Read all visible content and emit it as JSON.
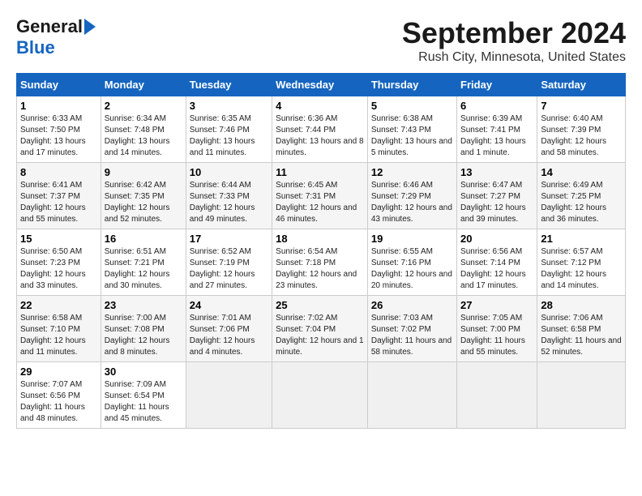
{
  "logo": {
    "text_general": "General",
    "text_blue": "Blue"
  },
  "title": "September 2024",
  "subtitle": "Rush City, Minnesota, United States",
  "days_of_week": [
    "Sunday",
    "Monday",
    "Tuesday",
    "Wednesday",
    "Thursday",
    "Friday",
    "Saturday"
  ],
  "weeks": [
    [
      {
        "day": "1",
        "sunrise": "6:33 AM",
        "sunset": "7:50 PM",
        "daylight": "13 hours and 17 minutes."
      },
      {
        "day": "2",
        "sunrise": "6:34 AM",
        "sunset": "7:48 PM",
        "daylight": "13 hours and 14 minutes."
      },
      {
        "day": "3",
        "sunrise": "6:35 AM",
        "sunset": "7:46 PM",
        "daylight": "13 hours and 11 minutes."
      },
      {
        "day": "4",
        "sunrise": "6:36 AM",
        "sunset": "7:44 PM",
        "daylight": "13 hours and 8 minutes."
      },
      {
        "day": "5",
        "sunrise": "6:38 AM",
        "sunset": "7:43 PM",
        "daylight": "13 hours and 5 minutes."
      },
      {
        "day": "6",
        "sunrise": "6:39 AM",
        "sunset": "7:41 PM",
        "daylight": "13 hours and 1 minute."
      },
      {
        "day": "7",
        "sunrise": "6:40 AM",
        "sunset": "7:39 PM",
        "daylight": "12 hours and 58 minutes."
      }
    ],
    [
      {
        "day": "8",
        "sunrise": "6:41 AM",
        "sunset": "7:37 PM",
        "daylight": "12 hours and 55 minutes."
      },
      {
        "day": "9",
        "sunrise": "6:42 AM",
        "sunset": "7:35 PM",
        "daylight": "12 hours and 52 minutes."
      },
      {
        "day": "10",
        "sunrise": "6:44 AM",
        "sunset": "7:33 PM",
        "daylight": "12 hours and 49 minutes."
      },
      {
        "day": "11",
        "sunrise": "6:45 AM",
        "sunset": "7:31 PM",
        "daylight": "12 hours and 46 minutes."
      },
      {
        "day": "12",
        "sunrise": "6:46 AM",
        "sunset": "7:29 PM",
        "daylight": "12 hours and 43 minutes."
      },
      {
        "day": "13",
        "sunrise": "6:47 AM",
        "sunset": "7:27 PM",
        "daylight": "12 hours and 39 minutes."
      },
      {
        "day": "14",
        "sunrise": "6:49 AM",
        "sunset": "7:25 PM",
        "daylight": "12 hours and 36 minutes."
      }
    ],
    [
      {
        "day": "15",
        "sunrise": "6:50 AM",
        "sunset": "7:23 PM",
        "daylight": "12 hours and 33 minutes."
      },
      {
        "day": "16",
        "sunrise": "6:51 AM",
        "sunset": "7:21 PM",
        "daylight": "12 hours and 30 minutes."
      },
      {
        "day": "17",
        "sunrise": "6:52 AM",
        "sunset": "7:19 PM",
        "daylight": "12 hours and 27 minutes."
      },
      {
        "day": "18",
        "sunrise": "6:54 AM",
        "sunset": "7:18 PM",
        "daylight": "12 hours and 23 minutes."
      },
      {
        "day": "19",
        "sunrise": "6:55 AM",
        "sunset": "7:16 PM",
        "daylight": "12 hours and 20 minutes."
      },
      {
        "day": "20",
        "sunrise": "6:56 AM",
        "sunset": "7:14 PM",
        "daylight": "12 hours and 17 minutes."
      },
      {
        "day": "21",
        "sunrise": "6:57 AM",
        "sunset": "7:12 PM",
        "daylight": "12 hours and 14 minutes."
      }
    ],
    [
      {
        "day": "22",
        "sunrise": "6:58 AM",
        "sunset": "7:10 PM",
        "daylight": "12 hours and 11 minutes."
      },
      {
        "day": "23",
        "sunrise": "7:00 AM",
        "sunset": "7:08 PM",
        "daylight": "12 hours and 8 minutes."
      },
      {
        "day": "24",
        "sunrise": "7:01 AM",
        "sunset": "7:06 PM",
        "daylight": "12 hours and 4 minutes."
      },
      {
        "day": "25",
        "sunrise": "7:02 AM",
        "sunset": "7:04 PM",
        "daylight": "12 hours and 1 minute."
      },
      {
        "day": "26",
        "sunrise": "7:03 AM",
        "sunset": "7:02 PM",
        "daylight": "11 hours and 58 minutes."
      },
      {
        "day": "27",
        "sunrise": "7:05 AM",
        "sunset": "7:00 PM",
        "daylight": "11 hours and 55 minutes."
      },
      {
        "day": "28",
        "sunrise": "7:06 AM",
        "sunset": "6:58 PM",
        "daylight": "11 hours and 52 minutes."
      }
    ],
    [
      {
        "day": "29",
        "sunrise": "7:07 AM",
        "sunset": "6:56 PM",
        "daylight": "11 hours and 48 minutes."
      },
      {
        "day": "30",
        "sunrise": "7:09 AM",
        "sunset": "6:54 PM",
        "daylight": "11 hours and 45 minutes."
      },
      null,
      null,
      null,
      null,
      null
    ]
  ]
}
